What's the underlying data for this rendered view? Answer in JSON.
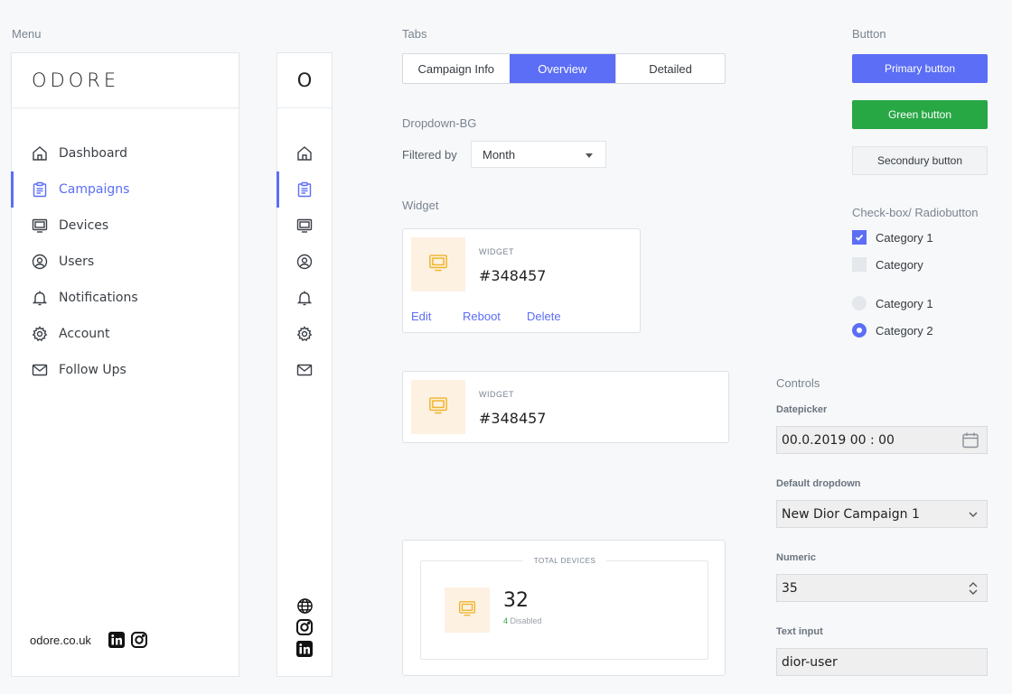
{
  "sections": {
    "menu": "Menu",
    "tabs": "Tabs",
    "button": "Button",
    "dropdown_bg": "Dropdown-BG",
    "widget": "Widget",
    "checkbox_radio": "Check-box/ Radiobutton",
    "controls": "Controls"
  },
  "sidebar": {
    "logo": "ODORE",
    "mini_logo": "O",
    "items": [
      {
        "label": "Dashboard",
        "icon": "home-icon",
        "active": false
      },
      {
        "label": "Campaigns",
        "icon": "clipboard-icon",
        "active": true
      },
      {
        "label": "Devices",
        "icon": "monitor-icon",
        "active": false
      },
      {
        "label": "Users",
        "icon": "user-circle-icon",
        "active": false
      },
      {
        "label": "Notifications",
        "icon": "bell-icon",
        "active": false
      },
      {
        "label": "Account",
        "icon": "gear-icon",
        "active": false
      },
      {
        "label": "Follow Ups",
        "icon": "mail-icon",
        "active": false
      }
    ],
    "footer_url": "odore.co.uk",
    "socials": [
      "linkedin-icon",
      "instagram-icon"
    ],
    "mini_socials": [
      "globe-icon",
      "instagram-icon",
      "linkedin-icon"
    ]
  },
  "tabs": [
    {
      "label": "Campaign Info",
      "active": false
    },
    {
      "label": "Overview",
      "active": true
    },
    {
      "label": "Detailed",
      "active": false
    }
  ],
  "filter": {
    "label": "Filtered by",
    "value": "Month"
  },
  "widget1": {
    "caption": "WIDGET",
    "value": "#348457",
    "actions": [
      "Edit",
      "Reboot",
      "Delete"
    ]
  },
  "widget2": {
    "caption": "WIDGET",
    "value": "#348457"
  },
  "total_devices": {
    "caption": "TOTAL DEVICES",
    "value": "32",
    "disabled_count": "4",
    "disabled_label": "Disabled"
  },
  "buttons": {
    "primary": "Primary button",
    "green": "Green button",
    "secondary": "Secondury button"
  },
  "checkboxes": [
    {
      "label": "Category 1",
      "checked": true
    },
    {
      "label": "Category",
      "checked": false
    }
  ],
  "radios": [
    {
      "label": "Category 1",
      "selected": false
    },
    {
      "label": "Category 2",
      "selected": true
    }
  ],
  "controls": {
    "datepicker_label": "Datepicker",
    "datepicker_value": "00.0.2019  00 : 00",
    "dropdown_label": "Default dropdown",
    "dropdown_value": "New Dior Campaign 1",
    "numeric_label": "Numeric",
    "numeric_value": "35",
    "text_label": "Text input",
    "text_value": "dior-user"
  },
  "colors": {
    "accent": "#5b6ef5",
    "green": "#28a745",
    "widget_icon_bg": "#fdf1e2",
    "widget_icon": "#f0b429"
  }
}
